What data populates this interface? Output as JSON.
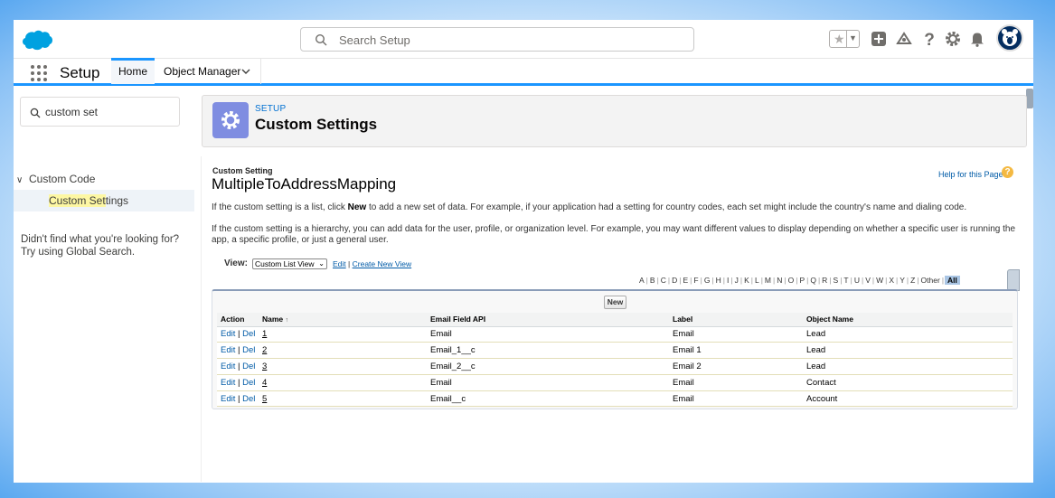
{
  "header": {
    "search_placeholder": "Search Setup"
  },
  "nav": {
    "app_name": "Setup",
    "tabs": [
      {
        "label": "Home"
      },
      {
        "label": "Object Manager"
      }
    ]
  },
  "sidebar": {
    "quick_find_value": "custom set",
    "tree_group": "Custom Code",
    "tree_item_highlight": "Custom Set",
    "tree_item_rest": "tings",
    "not_found_line1": "Didn't find what you're looking for?",
    "not_found_line2": "Try using Global Search."
  },
  "page_header": {
    "kicker": "SETUP",
    "title": "Custom Settings"
  },
  "content": {
    "type_label": "Custom Setting",
    "setting_name": "MultipleToAddressMapping",
    "help_link": "Help for this Page",
    "help_icon": "?",
    "para1_before": "If the custom setting is a list, click ",
    "para1_bold": "New",
    "para1_after": " to add a new set of data. For example, if your application had a setting for country codes, each set might include the country's name and dialing code.",
    "para2": "If the custom setting is a hierarchy, you can add data for the user, profile, or organization level. For example, you may want different values to display depending on whether a specific user is running the app, a specific profile, or just a general user.",
    "view_label": "View:",
    "view_selected": "Custom List View",
    "view_edit": "Edit",
    "view_sep": "|",
    "view_create": "Create New View",
    "alpha": [
      "A",
      "B",
      "C",
      "D",
      "E",
      "F",
      "G",
      "H",
      "I",
      "J",
      "K",
      "L",
      "M",
      "N",
      "O",
      "P",
      "Q",
      "R",
      "S",
      "T",
      "U",
      "V",
      "W",
      "X",
      "Y",
      "Z",
      "Other",
      "All"
    ],
    "new_button": "New"
  },
  "table": {
    "columns": [
      "Action",
      "Name",
      "Email Field API",
      "Label",
      "Object Name"
    ],
    "sort_indicator": "↑",
    "edit_label": "Edit",
    "del_label": "Del",
    "action_sep": "|",
    "rows": [
      {
        "name": "1",
        "email_field_api": "Email",
        "label": "Email",
        "object_name": "Lead"
      },
      {
        "name": "2",
        "email_field_api": "Email_1__c",
        "label": "Email 1",
        "object_name": "Lead"
      },
      {
        "name": "3",
        "email_field_api": "Email_2__c",
        "label": "Email 2",
        "object_name": "Lead"
      },
      {
        "name": "4",
        "email_field_api": "Email",
        "label": "Email",
        "object_name": "Contact"
      },
      {
        "name": "5",
        "email_field_api": "Email__c",
        "label": "Email",
        "object_name": "Account"
      }
    ]
  },
  "colors": {
    "brand_blue": "#1b96ff",
    "link_blue": "#015ba7",
    "header_icon_bg": "#7f8de1",
    "highlight": "#fdf7a3"
  }
}
